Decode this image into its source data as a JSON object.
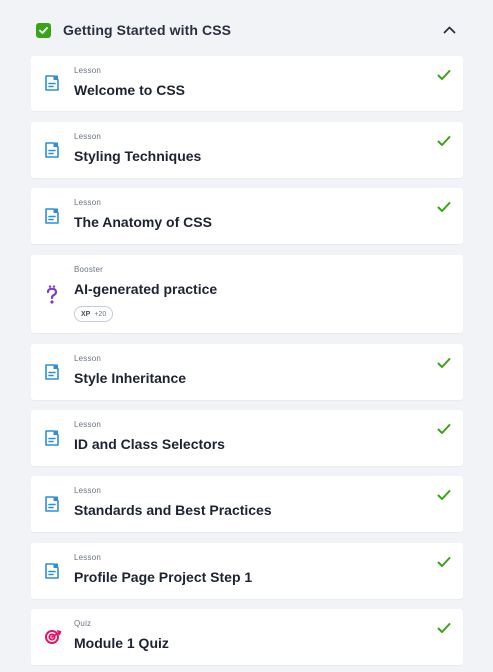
{
  "module": {
    "title": "Getting Started with CSS",
    "completed": true,
    "expanded": true
  },
  "colors": {
    "check_green": "#3aa31a",
    "lesson_icon_blue": "#2d8fd8",
    "booster_icon_purple": "#7b3fc4",
    "quiz_icon_pink": "#e0176a"
  },
  "items": [
    {
      "kind": "Lesson",
      "title": "Welcome to CSS",
      "icon": "lesson-document-icon",
      "completed": true
    },
    {
      "kind": "Lesson",
      "title": "Styling Techniques",
      "icon": "lesson-document-icon",
      "completed": true
    },
    {
      "kind": "Lesson",
      "title": "The Anatomy of CSS",
      "icon": "lesson-document-icon",
      "completed": true
    },
    {
      "kind": "Booster",
      "title": "AI-generated practice",
      "icon": "question-mark-icon",
      "completed": false,
      "badge": {
        "label": "XP",
        "value": "+20"
      }
    },
    {
      "kind": "Lesson",
      "title": "Style Inheritance",
      "icon": "lesson-document-icon",
      "completed": true
    },
    {
      "kind": "Lesson",
      "title": "ID and Class Selectors",
      "icon": "lesson-document-icon",
      "completed": true
    },
    {
      "kind": "Lesson",
      "title": "Standards and Best Practices",
      "icon": "lesson-document-icon",
      "completed": true
    },
    {
      "kind": "Lesson",
      "title": "Profile Page Project Step 1",
      "icon": "lesson-document-icon",
      "completed": true
    },
    {
      "kind": "Quiz",
      "title": "Module 1 Quiz",
      "icon": "target-icon",
      "completed": true
    }
  ]
}
